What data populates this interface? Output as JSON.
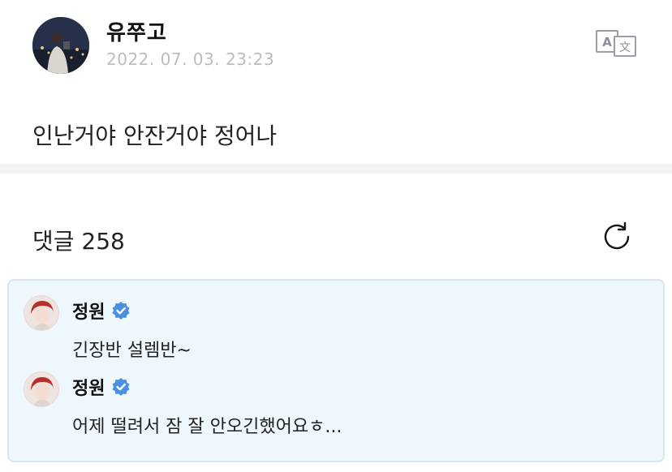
{
  "post": {
    "author": "유쭈고",
    "date": "2022. 07. 03. 23:23",
    "body": "인난거야 안잔거야 정어나"
  },
  "comments": {
    "header": "댓글 258",
    "items": [
      {
        "author": "정원",
        "text": "긴장반 설렘반~"
      },
      {
        "author": "정원",
        "text": "어제 떨려서 잠 잘 안오긴했어요ㅎ..."
      }
    ]
  },
  "icons": {
    "translate": "translate-icon",
    "refresh": "refresh-icon",
    "verified": "verified-badge-icon"
  },
  "colors": {
    "verified": "#4a90e2",
    "highlight_bg": "#eef7fb",
    "date": "#b8bcc4"
  }
}
